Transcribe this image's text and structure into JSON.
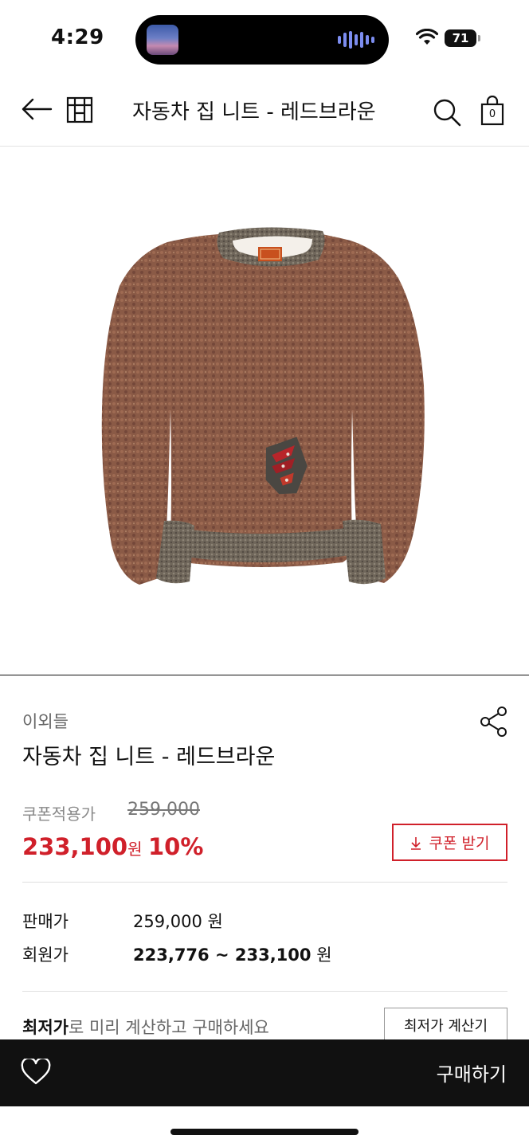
{
  "status": {
    "time": "4:29",
    "battery": "71"
  },
  "header": {
    "title": "자동차 집 니트 - 레드브라운",
    "cart_count": "0"
  },
  "icons": [
    "back-arrow-icon",
    "store-icon",
    "search-icon",
    "shopping-bag-icon",
    "share-icon",
    "heart-icon"
  ],
  "product": {
    "brand": "이외들",
    "name": "자동차 집 니트 - 레드브라운",
    "coupon_label": "쿠폰적용가",
    "original_price": "259,000",
    "sale_price": "233,100",
    "sale_unit": "원",
    "discount": "10%",
    "coupon_button": "쿠폰 받기"
  },
  "pricing": {
    "sell_label": "판매가",
    "sell_value": "259,000",
    "sell_unit": "원",
    "member_label": "회원가",
    "member_value": "223,776 ~ 233,100",
    "member_unit": "원"
  },
  "lowest": {
    "emphasis": "최저가",
    "text": "로 미리 계산하고 구매하세요",
    "button": "최저가 계산기"
  },
  "bottom": {
    "buy_label": "구매하기"
  },
  "colors": {
    "accent": "#d0202a",
    "bar": "#111111",
    "sweater": "#8a5a46"
  }
}
